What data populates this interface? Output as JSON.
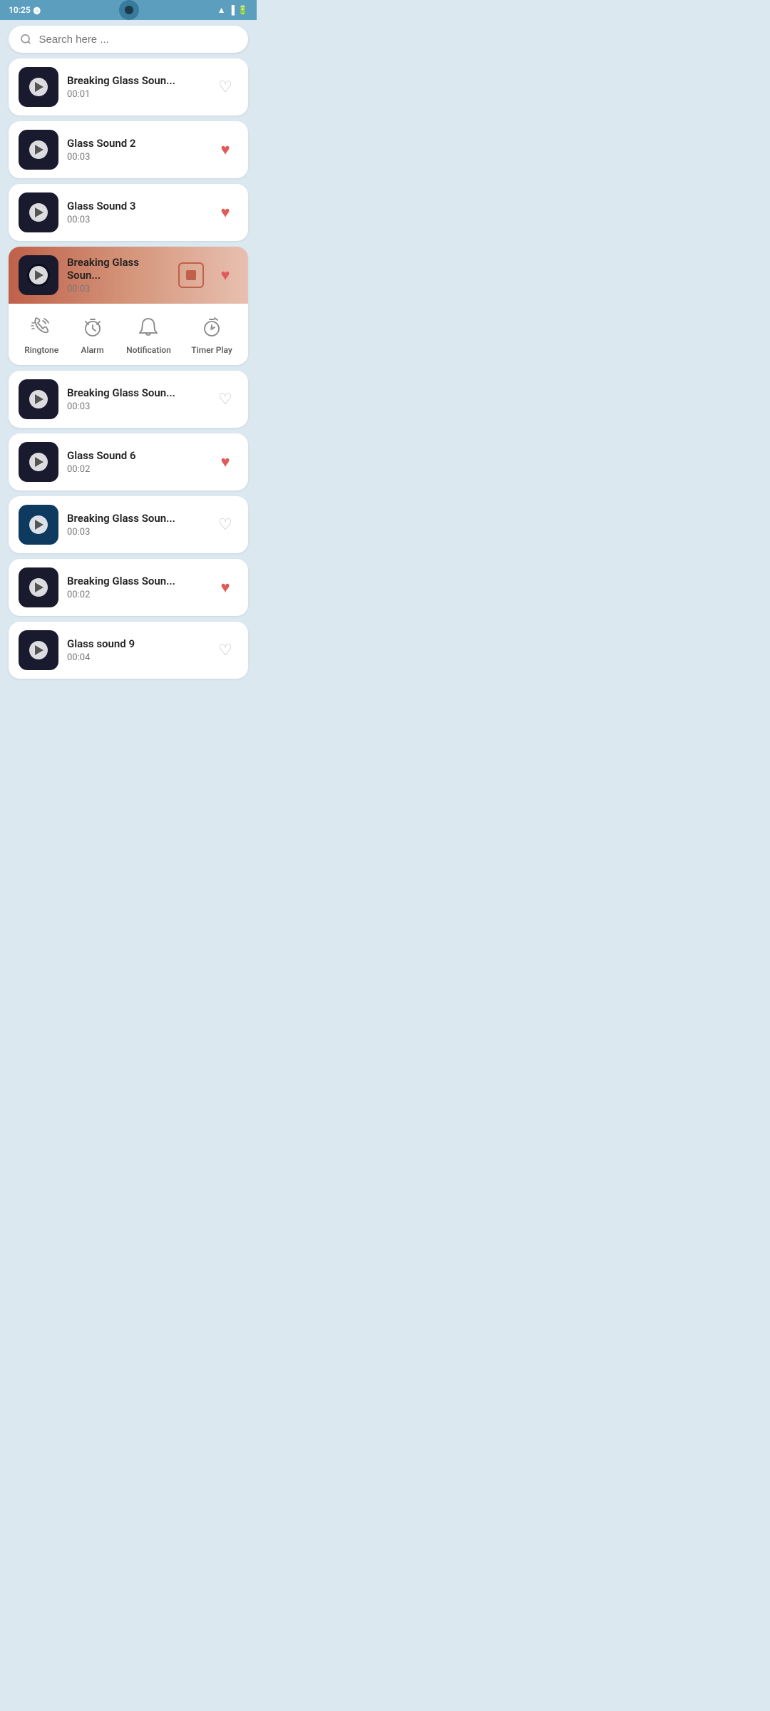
{
  "statusBar": {
    "time": "10:25",
    "wifi": true,
    "signal": true,
    "battery": true
  },
  "search": {
    "placeholder": "Search here ..."
  },
  "sounds": [
    {
      "id": 1,
      "title": "Breaking Glass Soun...",
      "duration": "00:01",
      "favorited": false,
      "active": false,
      "thumbStyle": "dark"
    },
    {
      "id": 2,
      "title": "Glass Sound 2",
      "duration": "00:03",
      "favorited": true,
      "active": false,
      "thumbStyle": "dark"
    },
    {
      "id": 3,
      "title": "Glass Sound 3",
      "duration": "00:03",
      "favorited": true,
      "active": false,
      "thumbStyle": "dark"
    },
    {
      "id": 4,
      "title": "Breaking Glass Soun...",
      "duration": "00:03",
      "favorited": true,
      "active": true,
      "playing": true,
      "thumbStyle": "dark"
    },
    {
      "id": 5,
      "title": "Breaking Glass Soun...",
      "duration": "00:03",
      "favorited": false,
      "active": false,
      "thumbStyle": "dark"
    },
    {
      "id": 6,
      "title": "Glass Sound 6",
      "duration": "00:02",
      "favorited": true,
      "active": false,
      "thumbStyle": "dark"
    },
    {
      "id": 7,
      "title": "Breaking Glass Soun...",
      "duration": "00:03",
      "favorited": false,
      "active": false,
      "thumbStyle": "blue"
    },
    {
      "id": 8,
      "title": "Breaking Glass Soun...",
      "duration": "00:02",
      "favorited": true,
      "active": false,
      "thumbStyle": "dark"
    },
    {
      "id": 9,
      "title": "Glass sound 9",
      "duration": "00:04",
      "favorited": false,
      "active": false,
      "thumbStyle": "dark"
    }
  ],
  "actions": [
    {
      "id": "ringtone",
      "label": "Ringtone",
      "icon": "📳"
    },
    {
      "id": "alarm",
      "label": "Alarm",
      "icon": "⏰"
    },
    {
      "id": "notification",
      "label": "Notification",
      "icon": "🔔"
    },
    {
      "id": "timerplay",
      "label": "Timer Play",
      "icon": "⏱"
    }
  ]
}
